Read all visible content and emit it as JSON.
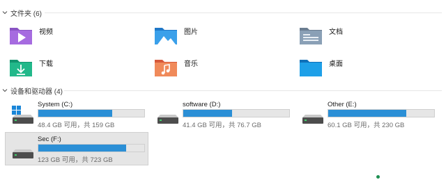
{
  "folders_group": {
    "label": "文件夹 (6)"
  },
  "folders": [
    {
      "name": "视频",
      "icon": "videos-folder-icon"
    },
    {
      "name": "图片",
      "icon": "pictures-folder-icon"
    },
    {
      "name": "文档",
      "icon": "documents-folder-icon"
    },
    {
      "name": "下载",
      "icon": "downloads-folder-icon"
    },
    {
      "name": "音乐",
      "icon": "music-folder-icon"
    },
    {
      "name": "桌面",
      "icon": "desktop-folder-icon"
    }
  ],
  "drives_group": {
    "label": "设备和驱动器 (4)"
  },
  "drives": [
    {
      "name": "System (C:)",
      "free_text": "48.4 GB 可用，共 159 GB",
      "used_fraction": 0.7,
      "windows_logo": true
    },
    {
      "name": "software (D:)",
      "free_text": "41.4 GB 可用，共 76.7 GB",
      "used_fraction": 0.46
    },
    {
      "name": "Other (E:)",
      "free_text": "60.1 GB 可用，共 230 GB",
      "used_fraction": 0.74
    },
    {
      "name": "Sec (F:)",
      "free_text": "123 GB 可用，共 723 GB",
      "used_fraction": 0.83,
      "selected": true
    }
  ],
  "colors": {
    "bar_fill": "#2b8fd6",
    "bar_bg": "#e6e6e6",
    "selection_bg": "#e5e5e5"
  }
}
